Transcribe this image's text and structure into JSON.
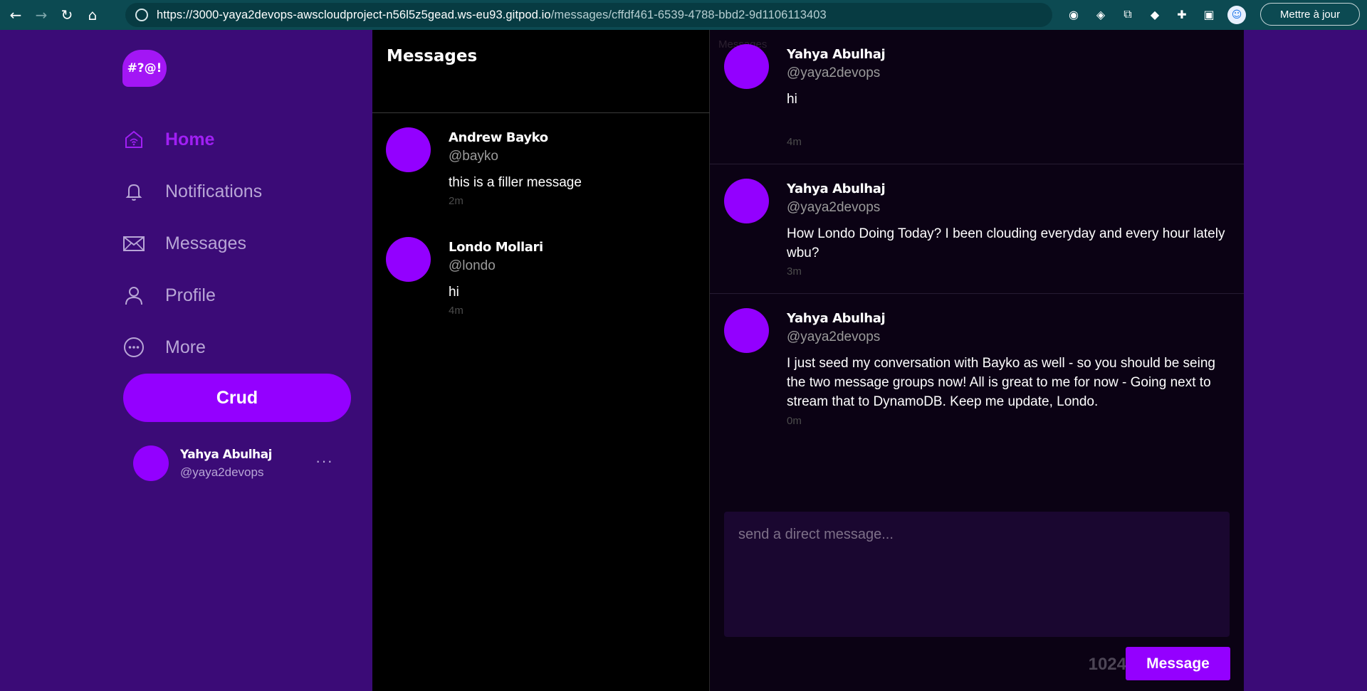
{
  "browser": {
    "url_host": "https://3000-yaya2devops-awscloudproject-n56l5z5gead.ws-eu93.gitpod.io",
    "url_path": "/messages/cffdf461-6539-4788-bbd2-9d1106113403",
    "update_label": "Mettre à jour"
  },
  "sidebar": {
    "logo_text": "#?@!",
    "nav": [
      {
        "label": "Home",
        "icon": "home-icon",
        "active": true
      },
      {
        "label": "Notifications",
        "icon": "bell-icon"
      },
      {
        "label": "Messages",
        "icon": "mail-icon"
      },
      {
        "label": "Profile",
        "icon": "user-icon"
      },
      {
        "label": "More",
        "icon": "more-circle-icon"
      }
    ],
    "crud_label": "Crud",
    "user": {
      "name": "Yahya Abulhaj",
      "handle": "@yaya2devops",
      "more": "···"
    }
  },
  "groups": {
    "title": "Messages",
    "items": [
      {
        "name": "Andrew Bayko",
        "handle": "@bayko",
        "message": "this is a filler message",
        "time": "2m"
      },
      {
        "name": "Londo Mollari",
        "handle": "@londo",
        "message": "hi",
        "time": "4m"
      }
    ]
  },
  "conversation": {
    "ghost_title": "Messages",
    "messages": [
      {
        "name": "Yahya Abulhaj",
        "handle": "@yaya2devops",
        "text": "hi",
        "time": "4m"
      },
      {
        "name": "Yahya Abulhaj",
        "handle": "@yaya2devops",
        "text": "How Londo Doing Today? I been clouding everyday and every hour lately wbu?",
        "time": "3m"
      },
      {
        "name": "Yahya Abulhaj",
        "handle": "@yaya2devops",
        "text": "I just seed my conversation with Bayko as well - so you should be seing the two message groups now! All is great to me for now - Going next to stream that to DynamoDB. Keep me update, Londo.",
        "time": "0m"
      }
    ],
    "composer_placeholder": "send a direct message...",
    "char_count": "1024",
    "send_label": "Message"
  },
  "colors": {
    "accent": "#9400ff",
    "sidebar_bg": "#3b0b77",
    "groups_bg": "#000000",
    "conversation_bg": "#0b0214"
  }
}
